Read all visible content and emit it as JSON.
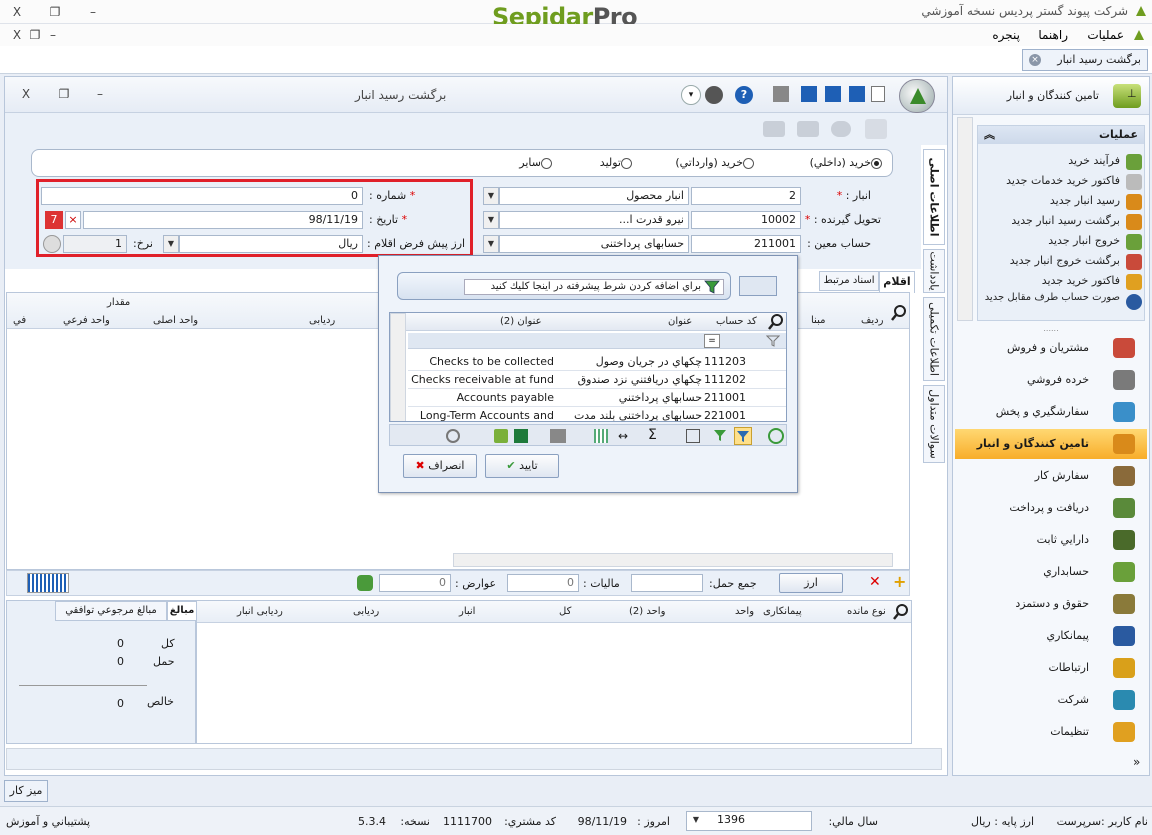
{
  "app": {
    "logo_a": "Sepidar",
    "logo_b": "Pro",
    "window_title": "شرکت پیوند گستر پردیس نسخه آموزشي",
    "close_glyph": "X",
    "restore_glyph": "❐",
    "minimize_glyph": "–"
  },
  "menu": {
    "items": [
      "عمليات",
      "راهنما",
      "پنجره"
    ]
  },
  "doc_tab": {
    "label": "برگشت رسيد انبار"
  },
  "window": {
    "title": "برگشت رسيد انبار"
  },
  "form": {
    "radios": [
      {
        "label": "خريد (داخلي)",
        "selected": true
      },
      {
        "label": "خريد (وارداتي)",
        "selected": false
      },
      {
        "label": "توليد",
        "selected": false
      },
      {
        "label": "ساير",
        "selected": false
      }
    ],
    "warehouse_label": "انبار :",
    "warehouse_code": "2",
    "warehouse_name": "انبار محصول",
    "receiver_label": "تحویل گیرنده :",
    "receiver_code": "10002",
    "receiver_name": "نيرو قدرت ا...",
    "account_label": "حساب معين :",
    "account_code": "211001",
    "account_name": "حسابهای پرداختنی",
    "number_label": "شماره :",
    "number_value": "0",
    "date_label": "تاریخ :",
    "date_value": "98/11/19",
    "currency_label": "ارز پيش فرض اقلام :",
    "currency_value": "ريال",
    "rate_label": "نرخ:",
    "rate_value": "1",
    "required_mark": "*"
  },
  "vtabs": [
    "اطلاعات اصلی",
    "یادداشت",
    "اطلاعات تکمیلی",
    "سوالات متداول"
  ],
  "grid_tabs": [
    "اقلام",
    "اسناد مرتبط"
  ],
  "grid_headers": {
    "quantity_group": "مقدار",
    "cols": [
      "رديف",
      "مبنا",
      "ردیابی",
      "واحد اصلی",
      "واحد فرعي",
      "في"
    ]
  },
  "popup": {
    "filter_hint": "براي اضافه کردن شرط پيشرفته در اينجا کليك کنيد",
    "headers": [
      "کد حساب",
      "عنوان",
      "عنوان (2)"
    ],
    "rows": [
      {
        "code": "111203",
        "title": "چکهاي در جريان وصول",
        "title2": "Checks to be collected"
      },
      {
        "code": "111202",
        "title": "چکهاي دريافتني نزد صندوق",
        "title2": "Checks receivable at fund"
      },
      {
        "code": "211001",
        "title": "حسابهاي پرداختني",
        "title2": "Accounts payable"
      },
      {
        "code": "221001",
        "title": "حسابهای پرداختني بلند مدت",
        "title2": "Long-Term Accounts and"
      }
    ],
    "ok_label": "تاييد",
    "cancel_label": "انصراف"
  },
  "summary_bar": {
    "currency_btn": "ارز",
    "shipping_label": "جمع حمل:",
    "tax_label": "ماليات :",
    "tax_value": "0",
    "duties_label": "عوارض :",
    "duties_value": "0"
  },
  "bottom_grid": {
    "cols": [
      "نوع مانده",
      "پیمانکاری",
      "واحد",
      "واحد (2)",
      "کل",
      "انبار",
      "ردیابی",
      "ردیابی انبار"
    ],
    "side_tabs": [
      "مبالغ",
      "مبالغ مرجوعي توافقي"
    ],
    "totals": [
      {
        "label": "کل",
        "value": "0"
      },
      {
        "label": "حمل",
        "value": "0"
      },
      {
        "label": "خالص",
        "value": "0"
      }
    ]
  },
  "sidebar": {
    "title": "تامين کنندگان و انبار",
    "ops_title": "عمليات",
    "ops": [
      "فرآيند خريد",
      "فاکتور خريد خدمات جديد",
      "رسيد انبار جديد",
      "برگشت رسيد انبار جديد",
      "خروج انبار جديد",
      "برگشت خروج انبار جديد",
      "فاکتور خريد جديد",
      "صورت حساب طرف مقابل جديد"
    ],
    "nav": [
      {
        "label": "مشتريان و فروش",
        "color": "#c94a3a",
        "selected": false
      },
      {
        "label": "خرده فروشي",
        "color": "#7a7a7a",
        "selected": false
      },
      {
        "label": "سفارشگيري و پخش",
        "color": "#3a8fc9",
        "selected": false
      },
      {
        "label": "تامين کنندگان و انبار",
        "color": "#d98a1a",
        "selected": true
      },
      {
        "label": "سفارش کار",
        "color": "#8a6a3a",
        "selected": false
      },
      {
        "label": "دريافت و پرداخت",
        "color": "#5a8a3a",
        "selected": false
      },
      {
        "label": "دارايي ثابت",
        "color": "#4a6a2a",
        "selected": false
      },
      {
        "label": "حسابداري",
        "color": "#6aa03a",
        "selected": false
      },
      {
        "label": "حقوق و دستمزد",
        "color": "#8a7a3a",
        "selected": false
      },
      {
        "label": "پيمانکاري",
        "color": "#2a5aa0",
        "selected": false
      },
      {
        "label": "ارتباطات",
        "color": "#d9a01a",
        "selected": false
      },
      {
        "label": "شرکت",
        "color": "#2a8ab0",
        "selected": false
      },
      {
        "label": "تنظيمات",
        "color": "#e0a020",
        "selected": false
      }
    ]
  },
  "desk_tab": "ميز کار",
  "status": {
    "user": "نام کاربر :سرپرست",
    "base_currency": "ارز پایه : ريال",
    "fiscal_year_label": "سال مالي:",
    "fiscal_year": "1396",
    "today_label": "امروز :",
    "today": "98/11/19",
    "customer_code_label": "کد مشتري:",
    "customer_code": "1111700",
    "version_label": "نسخه:",
    "version": "5.3.4",
    "support": "پشتيباني و آموزش"
  }
}
